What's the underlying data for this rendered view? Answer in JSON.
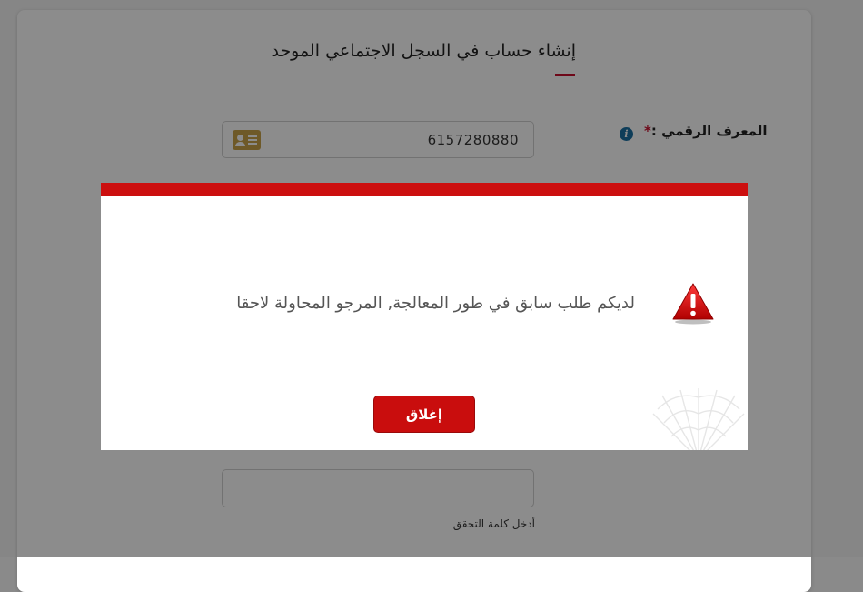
{
  "form": {
    "title": "إنشاء حساب في السجل الاجتماعي الموحد",
    "digital_id_label": "المعرف الرقمي :",
    "required_mark": "*",
    "info_icon": "info-icon",
    "digital_id_value": "6157280880",
    "id_card_icon": "id-card-icon",
    "otp_value": "",
    "otp_hint": "أدخل كلمة التحقق"
  },
  "modal": {
    "message": "لديكم طلب سابق في طور المعالجة, المرجو المحاولة لاحقا",
    "warning_icon": "warning-icon",
    "close_label": "إغلاق",
    "accent_color": "#cc0f0f"
  },
  "colors": {
    "brand_red": "#c8102e",
    "info_blue": "#1b6fa3",
    "card_gold": "#c9a24a"
  }
}
